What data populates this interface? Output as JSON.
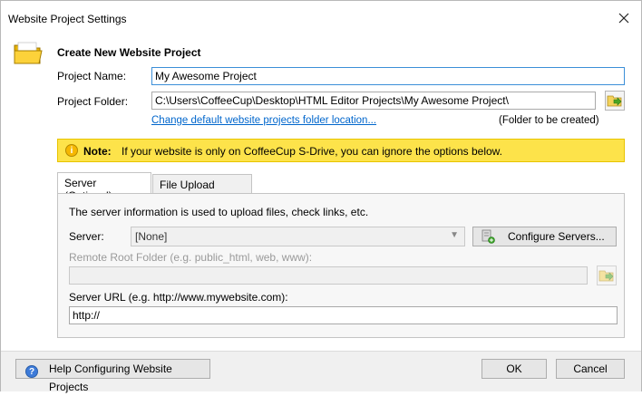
{
  "window": {
    "title": "Website Project Settings"
  },
  "heading": "Create New Website Project",
  "project_name": {
    "label": "Project Name:",
    "value": "My Awesome Project"
  },
  "project_folder": {
    "label": "Project Folder:",
    "value": "C:\\Users\\CoffeeCup\\Desktop\\HTML Editor Projects\\My Awesome Project\\"
  },
  "change_folder_link": "Change default website projects folder location...",
  "folder_status": "(Folder to be created)",
  "note": {
    "label": "Note:",
    "text": "If your website is only on CoffeeCup S-Drive, you can ignore the options below."
  },
  "tabs": [
    {
      "label": "Server (Optional)"
    },
    {
      "label": "File Upload Options"
    }
  ],
  "server_panel": {
    "info": "The server information is used to upload files, check links, etc.",
    "server_label": "Server:",
    "server_value": "[None]",
    "configure_button": "Configure Servers...",
    "remote_root_label": "Remote Root Folder (e.g. public_html, web, www):",
    "remote_root_value": "",
    "server_url_label": "Server URL (e.g. http://www.mywebsite.com):",
    "server_url_value": "http://"
  },
  "footer": {
    "help_button": "Help Configuring Website Projects",
    "ok_button": "OK",
    "cancel_button": "Cancel"
  },
  "colors": {
    "note_background": "#fde34a",
    "link": "#0066cc",
    "focus_border": "#3c8fd8"
  }
}
